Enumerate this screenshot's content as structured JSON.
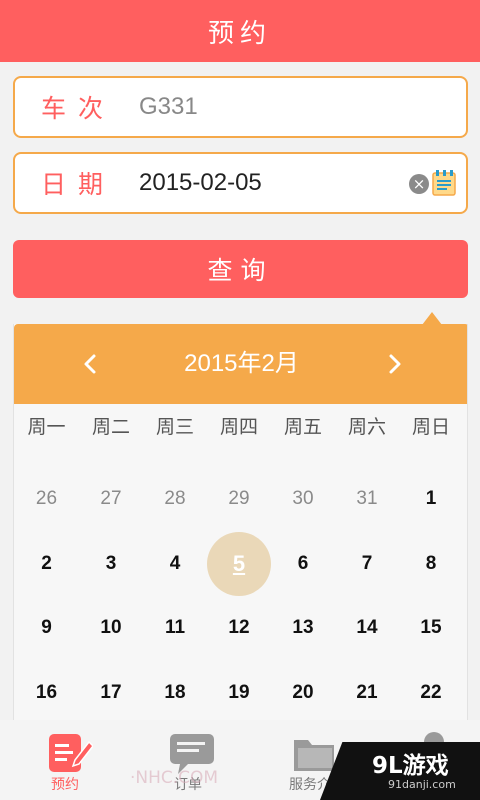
{
  "header": {
    "title": "预约"
  },
  "form": {
    "train": {
      "label": "车次",
      "value": "G331"
    },
    "date": {
      "label": "日期",
      "value": "2015-02-05"
    },
    "icons": {
      "clear": "clear-circle-icon",
      "calendar": "calendar-icon"
    }
  },
  "query_button": {
    "label": "查询"
  },
  "calendar": {
    "month_label": "2015年2月",
    "weekdays": [
      "周一",
      "周二",
      "周三",
      "周四",
      "周五",
      "周六",
      "周日"
    ],
    "weeks": [
      [
        "26",
        "27",
        "28",
        "29",
        "30",
        "31",
        "1"
      ],
      [
        "2",
        "3",
        "4",
        "5",
        "6",
        "7",
        "8"
      ],
      [
        "9",
        "10",
        "11",
        "12",
        "13",
        "14",
        "15"
      ],
      [
        "16",
        "17",
        "18",
        "19",
        "20",
        "21",
        "22"
      ]
    ],
    "selected_day": "5"
  },
  "tabs": [
    {
      "label": "预约",
      "icon": "reserve-icon",
      "active": true
    },
    {
      "label": "订单",
      "icon": "chat-icon",
      "active": false
    },
    {
      "label": "服务介",
      "icon": "folder-icon",
      "active": false
    },
    {
      "label": "",
      "icon": "user-icon",
      "active": false
    }
  ],
  "watermark": {
    "logo": "9L游戏",
    "domain": "91danji.com",
    "overlay_text": "·NHC.COM"
  },
  "colors": {
    "brand_red": "#ff5f5f",
    "accent_orange": "#f5a94a",
    "selected_day_bg": "#ead8b8"
  }
}
